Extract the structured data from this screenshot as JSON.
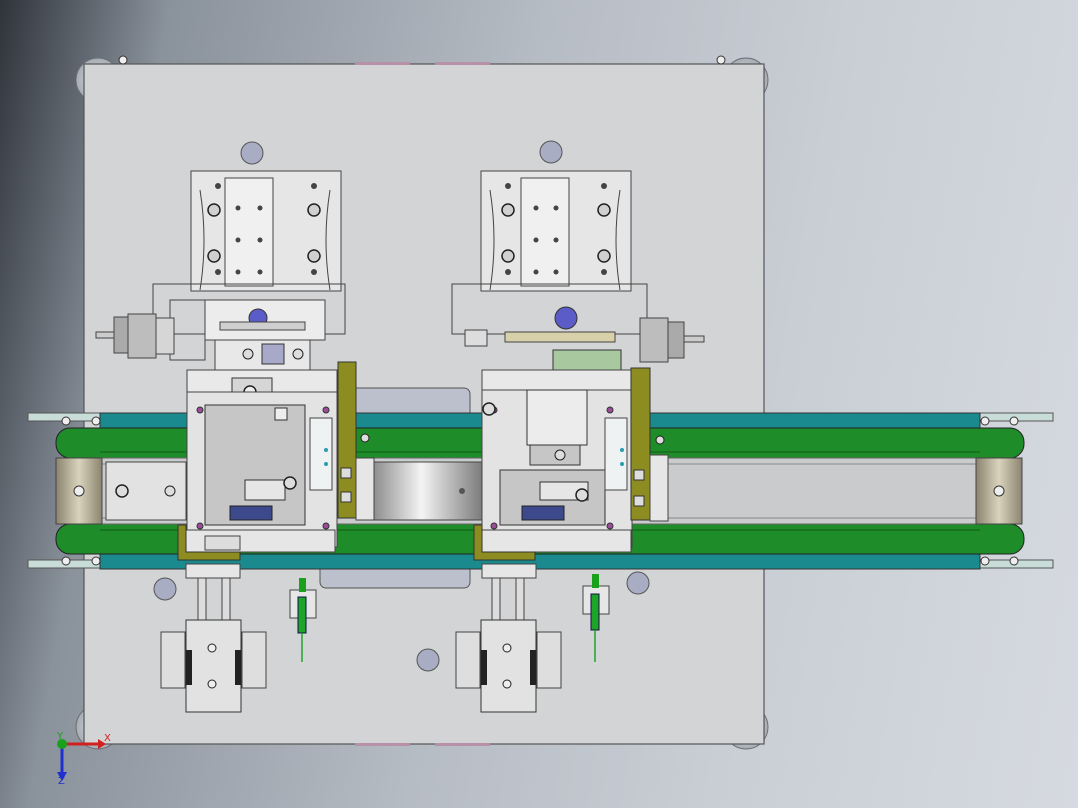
{
  "axes": {
    "x": "X",
    "y": "Y",
    "z": "Z"
  },
  "colors": {
    "background_dark": "#2f343b",
    "background_light": "#d6dae0",
    "plate": "#d3d4d6",
    "belt_green": "#1f8c2a",
    "teal_rail": "#1a8a8f",
    "olive_bracket": "#8c8c20",
    "blue_knob": "#5c5cc8",
    "axis_x": "#d02020",
    "axis_y": "#1aa01a",
    "axis_z": "#2030d0"
  }
}
